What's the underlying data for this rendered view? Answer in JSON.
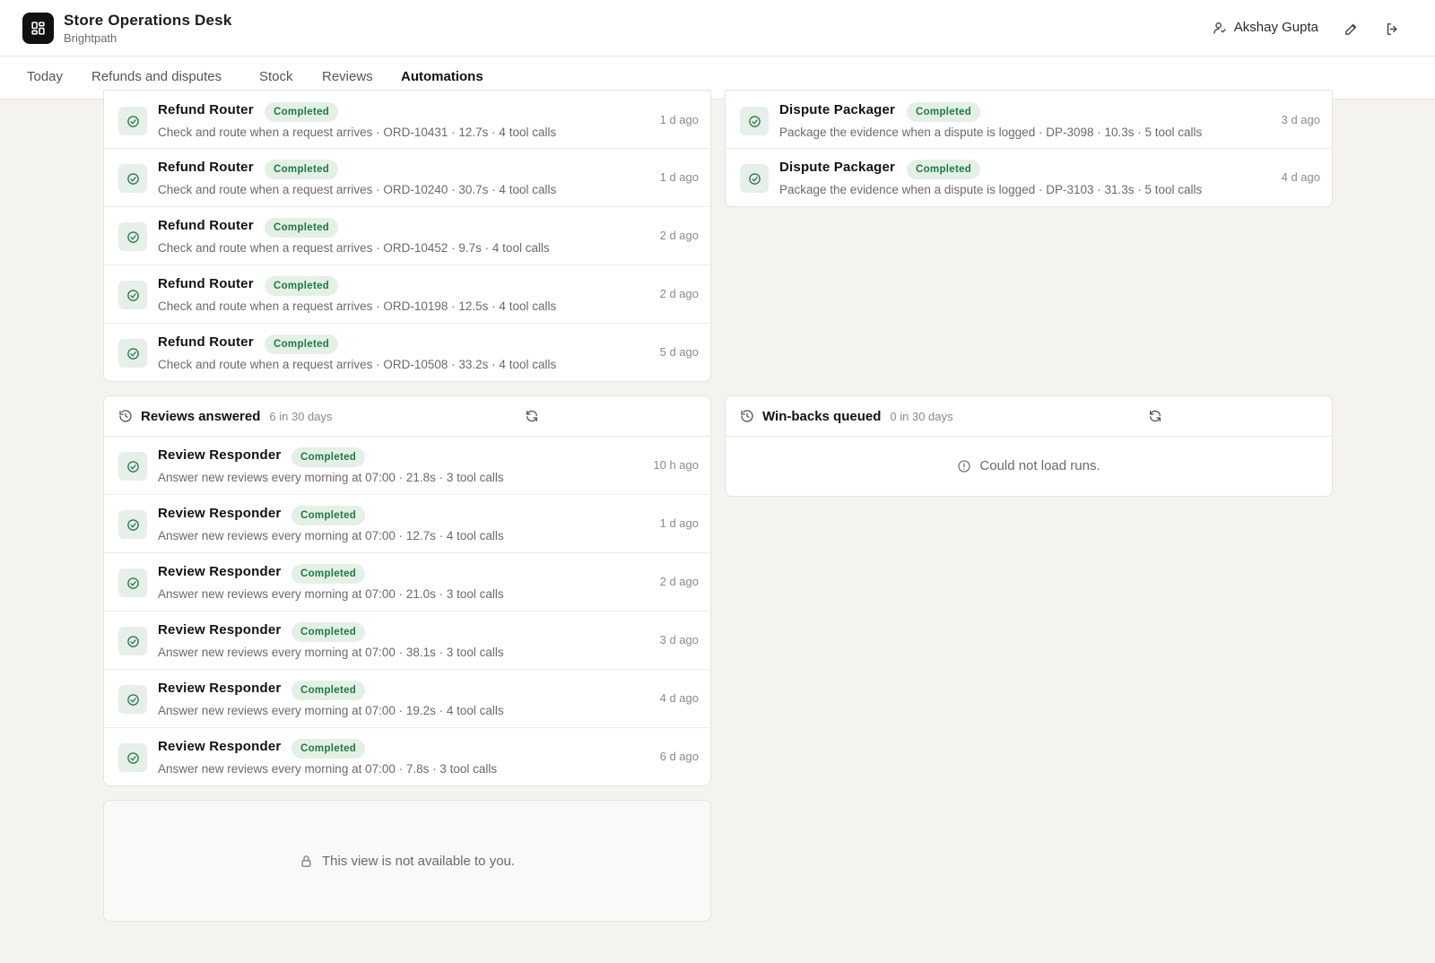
{
  "app": {
    "title": "Store Operations Desk",
    "subtitle": "Brightpath",
    "icon": "grid-icon"
  },
  "user": {
    "name": "Akshay Gupta",
    "icon": "user-icon"
  },
  "header_actions": {
    "edit_icon": "pencil-icon",
    "logout_icon": "logout-icon"
  },
  "tabs": [
    {
      "label": "Today"
    },
    {
      "label": "Refunds and disputes"
    },
    {
      "label": "Stock"
    },
    {
      "label": "Reviews"
    },
    {
      "label": "Automations"
    }
  ],
  "active_tab": "Automations",
  "colors": {
    "badge_bg": "#e4f0e6",
    "badge_text": "#1f7a44",
    "icon_bg": "#e6efe8",
    "icon_stroke": "#2f7d4f",
    "page_bg": "#f4f3f0"
  },
  "refund_runs": [
    {
      "name": "Refund Router",
      "status": "Completed",
      "desc": "Check and route when a request arrives · ORD-10431 · 12.7s · 4 tool calls",
      "time": "1 d ago"
    },
    {
      "name": "Refund Router",
      "status": "Completed",
      "desc": "Check and route when a request arrives · ORD-10240 · 30.7s · 4 tool calls",
      "time": "1 d ago"
    },
    {
      "name": "Refund Router",
      "status": "Completed",
      "desc": "Check and route when a request arrives · ORD-10452 · 9.7s · 4 tool calls",
      "time": "2 d ago"
    },
    {
      "name": "Refund Router",
      "status": "Completed",
      "desc": "Check and route when a request arrives · ORD-10198 · 12.5s · 4 tool calls",
      "time": "2 d ago"
    },
    {
      "name": "Refund Router",
      "status": "Completed",
      "desc": "Check and route when a request arrives · ORD-10508 · 33.2s · 4 tool calls",
      "time": "5 d ago"
    }
  ],
  "dispute_runs": [
    {
      "name": "Dispute Packager",
      "status": "Completed",
      "desc": "Package the evidence when a dispute is logged · DP-3098 · 10.3s · 5 tool calls",
      "time": "3 d ago"
    },
    {
      "name": "Dispute Packager",
      "status": "Completed",
      "desc": "Package the evidence when a dispute is logged · DP-3103 · 31.3s · 5 tool calls",
      "time": "4 d ago"
    }
  ],
  "reviews_card": {
    "title": "Reviews answered",
    "count": "6 in 30 days",
    "runs": [
      {
        "name": "Review Responder",
        "status": "Completed",
        "desc": "Answer new reviews every morning at 07:00 · 21.8s · 3 tool calls",
        "time": "10 h ago"
      },
      {
        "name": "Review Responder",
        "status": "Completed",
        "desc": "Answer new reviews every morning at 07:00 · 12.7s · 4 tool calls",
        "time": "1 d ago"
      },
      {
        "name": "Review Responder",
        "status": "Completed",
        "desc": "Answer new reviews every morning at 07:00 · 21.0s · 3 tool calls",
        "time": "2 d ago"
      },
      {
        "name": "Review Responder",
        "status": "Completed",
        "desc": "Answer new reviews every morning at 07:00 · 38.1s · 3 tool calls",
        "time": "3 d ago"
      },
      {
        "name": "Review Responder",
        "status": "Completed",
        "desc": "Answer new reviews every morning at 07:00 · 19.2s · 4 tool calls",
        "time": "4 d ago"
      },
      {
        "name": "Review Responder",
        "status": "Completed",
        "desc": "Answer new reviews every morning at 07:00 · 7.8s · 3 tool calls",
        "time": "6 d ago"
      }
    ]
  },
  "winbacks_card": {
    "title": "Win-backs queued",
    "count": "0 in 30 days",
    "error": "Could not load runs."
  },
  "locked_card": {
    "message": "This view is not available to you."
  }
}
